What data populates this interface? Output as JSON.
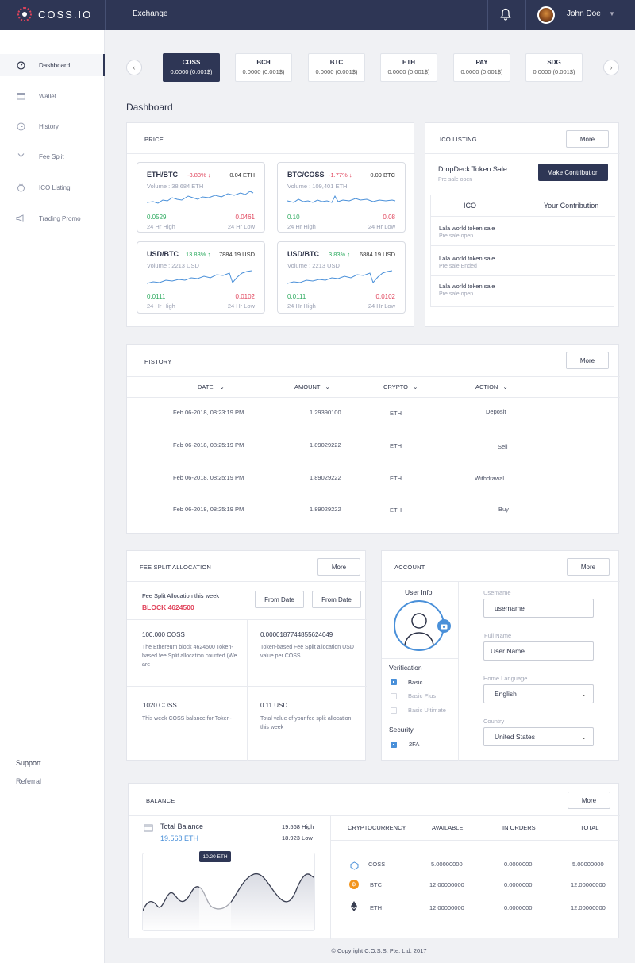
{
  "topbar": {
    "logo": "COSS.IO",
    "title": "Exchange",
    "user": "John Doe"
  },
  "sidebar": {
    "items": [
      {
        "label": "Dashboard",
        "icon": "dashboard-icon"
      },
      {
        "label": "Wallet",
        "icon": "wallet-icon"
      },
      {
        "label": "History",
        "icon": "history-icon"
      },
      {
        "label": "Fee Split",
        "icon": "fee-split-icon"
      },
      {
        "label": "ICO Listing",
        "icon": "ico-icon"
      },
      {
        "label": "Trading Promo",
        "icon": "megaphone-icon"
      }
    ],
    "support": "Support",
    "referral": "Referral"
  },
  "tickers": [
    {
      "name": "COSS",
      "value": "0.0000 (0.001$)"
    },
    {
      "name": "BCH",
      "value": "0.0000 (0.001$)"
    },
    {
      "name": "BTC",
      "value": "0.0000 (0.001$)"
    },
    {
      "name": "ETH",
      "value": "0.0000 (0.001$)"
    },
    {
      "name": "PAY",
      "value": "0.0000 (0.001$)"
    },
    {
      "name": "SDG",
      "value": "0.0000 (0.001$)"
    }
  ],
  "dashboard_title": "Dashboard",
  "price": {
    "title": "PRICE",
    "cards": [
      {
        "pair": "ETH/BTC",
        "change": "-3.83%",
        "dir": "↓",
        "value": "0.04 ETH",
        "volume": "Volume : 38,684 ETH",
        "high": "0.0529",
        "low": "0.0461",
        "high_label": "24 Hr High",
        "low_label": "24 Hr Low"
      },
      {
        "pair": "BTC/COSS",
        "change": "-1.77%",
        "dir": "↓",
        "value": "0.09 BTC",
        "volume": "Volume : 109,401 ETH",
        "high": "0.10",
        "low": "0.08",
        "high_label": "24 Hr High",
        "low_label": "24 Hr Low"
      },
      {
        "pair": "USD/BTC",
        "change": "13.83%",
        "dir": "↑",
        "value": "7884.19 USD",
        "volume": "Volume : 2213 USD",
        "high": "0.0111",
        "low": "0.0102",
        "high_label": "24 Hr High",
        "low_label": "24 Hr Low"
      },
      {
        "pair": "USD/BTC",
        "change": "3.83%",
        "dir": "↑",
        "value": "6884.19 USD",
        "volume": "Volume : 2213 USD",
        "high": "0.0111",
        "low": "0.0102",
        "high_label": "24 Hr High",
        "low_label": "24 Hr Low"
      }
    ]
  },
  "ico": {
    "title": "ICO LISTING",
    "more": "More",
    "featured": {
      "name": "DropDeck Token Sale",
      "status": "Pre sale open",
      "button": "Make Contribution"
    },
    "col_ico": "ICO",
    "col_contrib": "Your Contribution",
    "rows": [
      {
        "name": "Lala world token sale",
        "status": "Pre sale open"
      },
      {
        "name": "Lala world token sale",
        "status": "Pre sale Ended"
      },
      {
        "name": "Lala world token sale",
        "status": "Pre sale open"
      }
    ]
  },
  "history": {
    "title": "HISTORY",
    "more": "More",
    "headers": [
      "DATE",
      "AMOUNT",
      "CRYPTO",
      "ACTION"
    ],
    "rows": [
      {
        "date": "Feb 06-2018, 08:23:19 PM",
        "amount": "1.29390100",
        "crypto": "ETH",
        "action": "Deposit"
      },
      {
        "date": "Feb 06-2018, 08:25:19 PM",
        "amount": "1.89029222",
        "crypto": "ETH",
        "action": "Sell"
      },
      {
        "date": "Feb 06-2018, 08:25:19 PM",
        "amount": "1.89029222",
        "crypto": "ETH",
        "action": "Withdrawal"
      },
      {
        "date": "Feb 06-2018, 08:25:19 PM",
        "amount": "1.89029222",
        "crypto": "ETH",
        "action": "Buy"
      }
    ]
  },
  "fee": {
    "title": "FEE SPLIT ALLOCATION",
    "more": "More",
    "week_label": "Fee Split Allocation this week",
    "block": "BLOCK 4624500",
    "from1": "From Date",
    "from2": "From Date",
    "cells": [
      {
        "value": "100.000 COSS",
        "desc": "The Ethereum block 4624500 Token-based fee Split allocation counted (We are"
      },
      {
        "value": "0.0000187744855624649",
        "desc": "Token-based Fee Split allocation USD value per COSS"
      },
      {
        "value": "1020 COSS",
        "desc": "This week COSS balance for Token-"
      },
      {
        "value": "0.11 USD",
        "desc": "Total value of your fee split allocation this week"
      }
    ]
  },
  "account": {
    "title": "ACCOUNT",
    "more": "More",
    "user_info": "User Info",
    "verification": "Verification",
    "verif_items": [
      "Basic",
      "Basic Plus",
      "Basic Ultimate"
    ],
    "security": "Security",
    "security_items": [
      "2FA"
    ],
    "username_label": "Username",
    "username": "username",
    "fullname_label": "Full Name",
    "fullname": "User Name",
    "lang_label": "Home Language",
    "lang": "English",
    "country_label": "Country",
    "country": "United States"
  },
  "balance": {
    "title": "BALANCE",
    "more": "More",
    "total_label": "Total Balance",
    "total": "19.568 ETH",
    "high": "19.568 High",
    "low": "18.923 Low",
    "tooltip": "10.20 ETH",
    "headers": [
      "CRYPTOCURRENCY",
      "AVAILABLE",
      "IN ORDERS",
      "TOTAL"
    ],
    "rows": [
      {
        "coin": "COSS",
        "available": "5.00000000",
        "orders": "0.0000000",
        "total": "5.00000000"
      },
      {
        "coin": "BTC",
        "available": "12.00000000",
        "orders": "0.0000000",
        "total": "12.00000000"
      },
      {
        "coin": "ETH",
        "available": "12.00000000",
        "orders": "0.0000000",
        "total": "12.00000000"
      }
    ]
  },
  "footer": "© Copyright C.O.S.S. Pte. Ltd. 2017"
}
